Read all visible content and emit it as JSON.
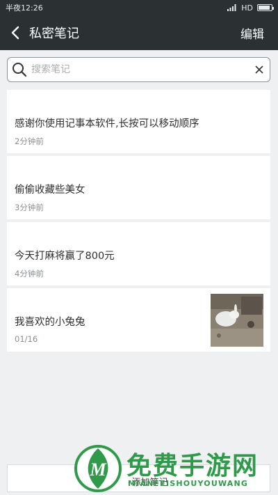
{
  "status_bar": {
    "time": "半夜12:26",
    "network": "HD",
    "battery_level": 0.9
  },
  "header": {
    "title": "私密笔记",
    "edit_label": "编辑"
  },
  "search": {
    "placeholder": "搜索笔记",
    "value": ""
  },
  "notes": [
    {
      "title": "感谢你使用记事本软件,长按可以移动顺序",
      "time": "2分钟前"
    },
    {
      "title": "偷偷收藏些美女",
      "time": "3分钟前"
    },
    {
      "title": "今天打麻将赢了800元",
      "time": "4分钟前"
    },
    {
      "title": "我喜欢的小兔兔",
      "time": "01/16",
      "has_image": true
    }
  ],
  "footer": {
    "add_label": "添加笔记"
  },
  "watermark": {
    "text": "免费手游网",
    "subtext": "MIANFEISHOUYOUWANG",
    "logo_letter": "M"
  },
  "colors": {
    "header_bg": "#2b3033",
    "page_bg": "#eef0f2",
    "watermark_green": "#2e9a4a"
  }
}
